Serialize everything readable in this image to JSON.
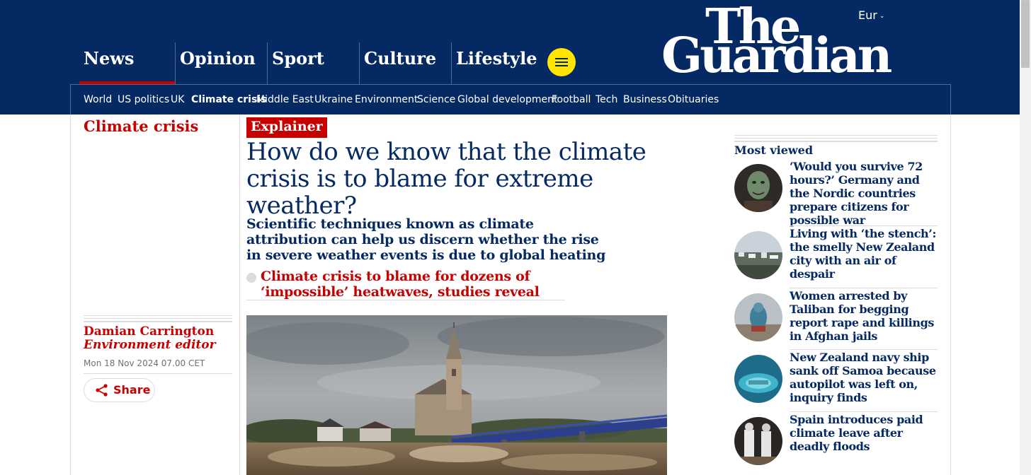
{
  "header": {
    "edition": "Eur",
    "logo_line1": "The",
    "logo_line2": "Guardian",
    "pillars": [
      {
        "label": "News",
        "active": true
      },
      {
        "label": "Opinion"
      },
      {
        "label": "Sport"
      },
      {
        "label": "Culture"
      },
      {
        "label": "Lifestyle"
      }
    ],
    "subnav": [
      {
        "label": "World"
      },
      {
        "label": "US politics"
      },
      {
        "label": "UK"
      },
      {
        "label": "Climate crisis",
        "active": true
      },
      {
        "label": "Middle East"
      },
      {
        "label": "Ukraine"
      },
      {
        "label": "Environment"
      },
      {
        "label": "Science"
      },
      {
        "label": "Global development"
      },
      {
        "label": "Football"
      },
      {
        "label": "Tech"
      },
      {
        "label": "Business"
      },
      {
        "label": "Obituaries"
      }
    ]
  },
  "article": {
    "section": "Climate crisis",
    "kicker": "Explainer",
    "headline": "How do we know that the climate crisis is to blame for extreme weather?",
    "standfirst": "Scientific techniques known as climate attribution can help us discern whether the rise in severe weather events is due to global heating",
    "related_link": "Climate crisis to blame for dozens of ‘impossible’ heatwaves, studies reveal",
    "author": "Damian Carrington",
    "author_role": "Environment editor",
    "dateline": "Mon 18 Nov 2024 07.00 CET",
    "share_label": "Share"
  },
  "most_viewed": {
    "title": "Most viewed",
    "items": [
      {
        "text": "‘Would you survive 72 hours?’ Germany and the Nordic countries prepare citizens for possible war"
      },
      {
        "text": "Living with ‘the stench’: the smelly New Zealand city with an air of despair"
      },
      {
        "text": "Women arrested by Taliban for begging report rape and killings in Afghan jails"
      },
      {
        "text": "New Zealand navy ship sank off Samoa because autopilot was left on, inquiry finds"
      },
      {
        "text": "Spain introduces paid climate leave after deadly floods"
      }
    ]
  },
  "colors": {
    "brand_blue": "#052962",
    "news_red": "#c70000",
    "menu_yellow": "#ffe500"
  }
}
